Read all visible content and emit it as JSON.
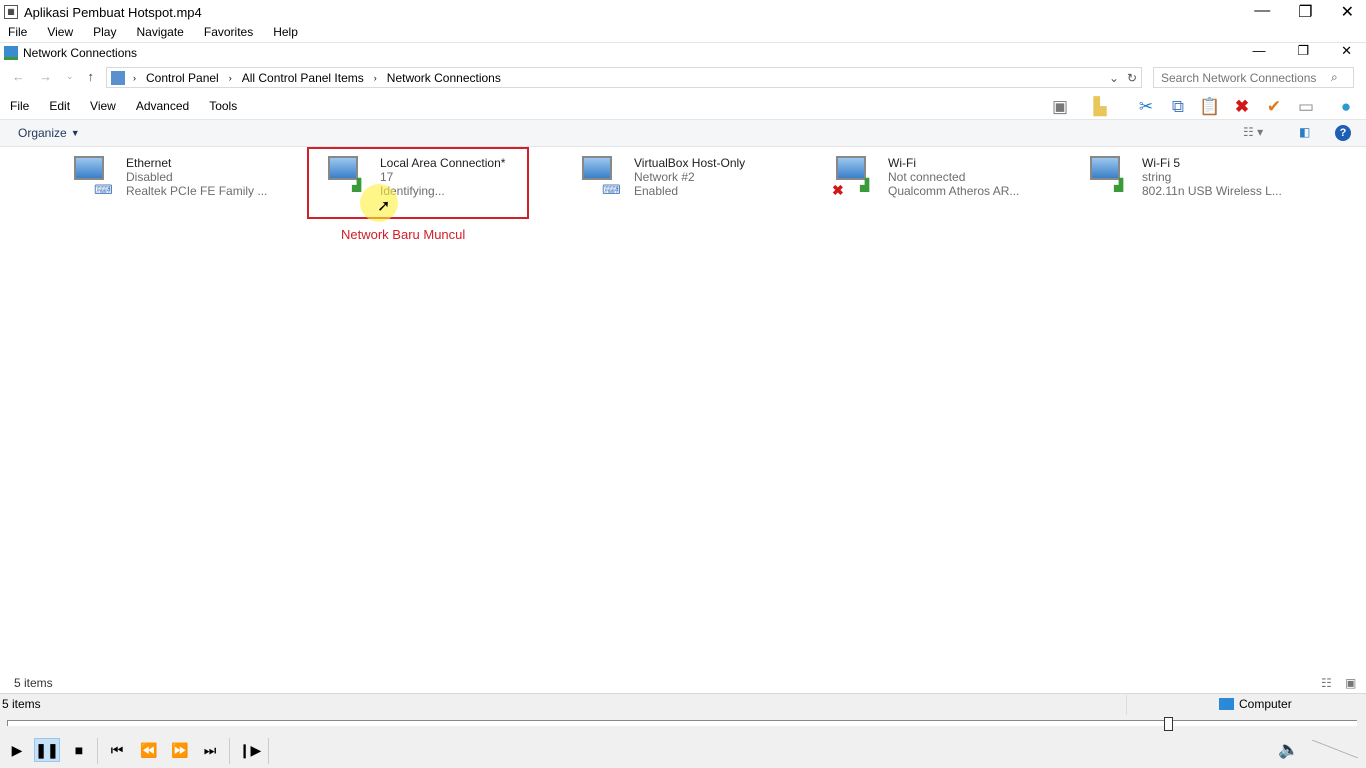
{
  "player": {
    "title": "Aplikasi Pembuat Hotspot.mp4",
    "menu": [
      "File",
      "View",
      "Play",
      "Navigate",
      "Favorites",
      "Help"
    ],
    "status_left": "5 items",
    "status_right": "Computer",
    "progress_percent": 86
  },
  "explorer": {
    "title": "Network Connections",
    "breadcrumb": [
      "Control Panel",
      "All Control Panel Items",
      "Network Connections"
    ],
    "search_placeholder": "Search Network Connections",
    "menu": [
      "File",
      "Edit",
      "View",
      "Advanced",
      "Tools"
    ],
    "organize": "Organize",
    "item_count": "5 items",
    "items": [
      {
        "name": "Ethernet",
        "line2": "Disabled",
        "line3": "Realtek PCIe FE Family ..."
      },
      {
        "name": "Local Area Connection*",
        "line2": "17",
        "line3": "Identifying..."
      },
      {
        "name": "VirtualBox Host-Only",
        "line2": "Network #2",
        "line3": "Enabled"
      },
      {
        "name": "Wi-Fi",
        "line2": "Not connected",
        "line3": "Qualcomm Atheros AR..."
      },
      {
        "name": "Wi-Fi 5",
        "line2": "string",
        "line3": "802.11n USB Wireless L..."
      }
    ]
  },
  "annotation": {
    "label": "Network Baru Muncul",
    "color": "#d0202a"
  }
}
